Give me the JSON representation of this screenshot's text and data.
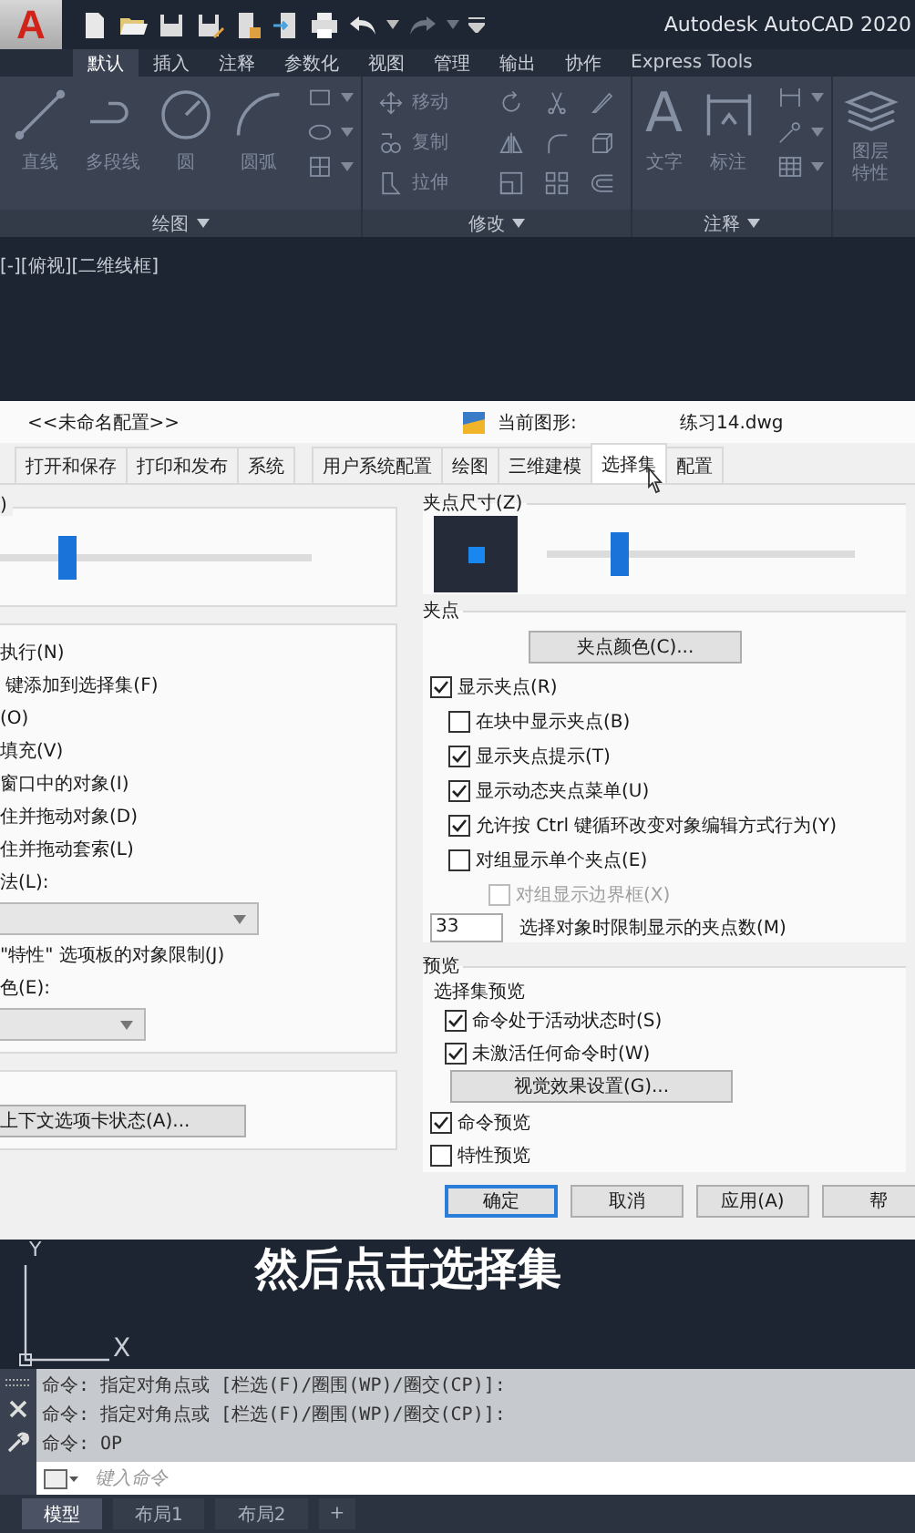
{
  "title_bar": {
    "app_button": "A",
    "title": "Autodesk AutoCAD 2020"
  },
  "ribbon": {
    "tabs": [
      {
        "label": "默认",
        "selected": true
      },
      {
        "label": "插入",
        "selected": false
      },
      {
        "label": "注释",
        "selected": false
      },
      {
        "label": "参数化",
        "selected": false
      },
      {
        "label": "视图",
        "selected": false
      },
      {
        "label": "管理",
        "selected": false
      },
      {
        "label": "输出",
        "selected": false
      },
      {
        "label": "协作",
        "selected": false
      },
      {
        "label": "Express Tools",
        "selected": false
      }
    ],
    "panels": [
      {
        "title": "绘图",
        "tools": [
          {
            "kind": "large",
            "label": "直线"
          },
          {
            "kind": "large",
            "label": "多段线"
          },
          {
            "kind": "large",
            "label": "圆"
          },
          {
            "kind": "large",
            "label": "圆弧"
          }
        ]
      },
      {
        "title": "修改",
        "tools": [
          {
            "kind": "small",
            "label": "移动"
          },
          {
            "kind": "small",
            "label": "复制"
          },
          {
            "kind": "small",
            "label": "拉伸"
          }
        ]
      },
      {
        "title": "注释",
        "tools": [
          {
            "kind": "large",
            "label": "文字",
            "glyph": "A"
          },
          {
            "kind": "large",
            "label": "标注"
          }
        ]
      },
      {
        "tools": [
          {
            "kind": "large",
            "label": "图层特性"
          }
        ]
      }
    ]
  },
  "viewport_label": "[-][俯视][二维线框]",
  "dialog": {
    "profile": "<<未命名配置>>",
    "current_drawing_label": "当前图形:",
    "current_drawing": "练习14.dwg",
    "tabs": [
      {
        "label": "打开和保存",
        "selected": false
      },
      {
        "label": "打印和发布",
        "selected": false
      },
      {
        "label": "系统",
        "selected": false
      },
      {
        "label": "用户系统配置",
        "selected": false
      },
      {
        "label": "绘图",
        "selected": false
      },
      {
        "label": "三维建模",
        "selected": false
      },
      {
        "label": "选择集",
        "selected": true
      },
      {
        "label": "配置",
        "selected": false
      }
    ],
    "pickbox": {
      "legend": ")",
      "level": 0.2
    },
    "selection_modes": [
      {
        "kind": "text",
        "label": "执行(N)"
      },
      {
        "kind": "text",
        "label": " 键添加到选择集(F)"
      },
      {
        "kind": "text",
        "label": "(O)"
      },
      {
        "kind": "text",
        "label": "填充(V)"
      },
      {
        "kind": "text",
        "label": "窗口中的对象(I)"
      },
      {
        "kind": "text",
        "label": "住并拖动对象(D)"
      },
      {
        "kind": "text",
        "label": "住并拖动套索(L)"
      },
      {
        "kind": "text",
        "label": "法(L):"
      },
      {
        "kind": "dropdown"
      },
      {
        "kind": "text",
        "label": "\"特性\" 选项板的对象限制(J)"
      },
      {
        "kind": "text",
        "label": "色(E):"
      },
      {
        "kind": "dropdown"
      }
    ],
    "ribbon_options_button": "上下文选项卡状态(A)...",
    "grip_size": {
      "legend": "夹点尺寸(Z)",
      "level": 0.22
    },
    "grips": {
      "legend": "夹点",
      "color_button": "夹点颜色(C)...",
      "checks": [
        {
          "label": "显示夹点(R)",
          "checked": true,
          "disabled": false,
          "children": [
            {
              "label": "在块中显示夹点(B)",
              "checked": false,
              "disabled": false
            },
            {
              "label": "显示夹点提示(T)",
              "checked": true,
              "disabled": false
            },
            {
              "label": "显示动态夹点菜单(U)",
              "checked": true,
              "disabled": false
            },
            {
              "label": "允许按 Ctrl 键循环改变对象编辑方式行为(Y)",
              "checked": true,
              "disabled": false
            },
            {
              "label": "对组显示单个夹点(E)",
              "checked": false,
              "disabled": false,
              "children": [
                {
                  "label": "对组显示边界框(X)",
                  "checked": false,
                  "disabled": true
                }
              ]
            }
          ]
        }
      ],
      "limit_value": "33",
      "limit_label": "选择对象时限制显示的夹点数(M)"
    },
    "preview": {
      "legend": "预览",
      "subheading": "选择集预览",
      "selection_checks": [
        {
          "label": "命令处于活动状态时(S)",
          "checked": true
        },
        {
          "label": "未激活任何命令时(W)",
          "checked": true
        }
      ],
      "effects_button": "视觉效果设置(G)...",
      "checks": [
        {
          "label": "命令预览",
          "checked": true
        },
        {
          "label": "特性预览",
          "checked": false
        }
      ]
    },
    "buttons": [
      {
        "label": "确定",
        "focused": true
      },
      {
        "label": "取消",
        "focused": false
      },
      {
        "label": "应用(A)",
        "focused": false
      },
      {
        "label": "帮",
        "focused": false
      }
    ]
  },
  "caption": "然后点击选择集",
  "ucs": {
    "x_label": "X",
    "y_label": "Y"
  },
  "command_line": {
    "history": [
      "命令: 指定对角点或 [栏选(F)/圈围(WP)/圈交(CP)]:",
      "命令: 指定对角点或 [栏选(F)/圈围(WP)/圈交(CP)]:",
      "命令: OP"
    ],
    "placeholder": "键入命令"
  },
  "layout_tabs": {
    "tabs": [
      {
        "label": "模型",
        "selected": true
      },
      {
        "label": "布局1",
        "selected": false
      },
      {
        "label": "布局2",
        "selected": false
      }
    ],
    "add": "+"
  }
}
